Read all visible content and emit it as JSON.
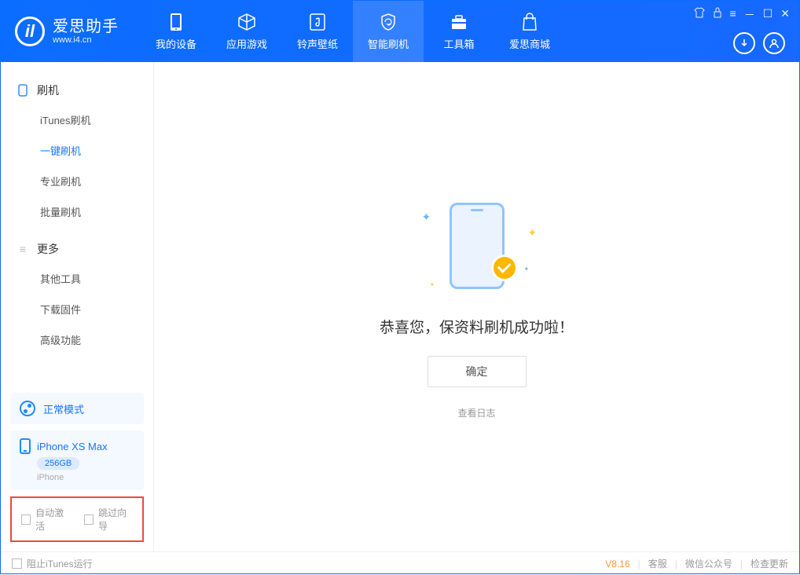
{
  "app": {
    "title": "爱思助手",
    "subtitle": "www.i4.cn"
  },
  "nav": {
    "items": [
      {
        "label": "我的设备"
      },
      {
        "label": "应用游戏"
      },
      {
        "label": "铃声壁纸"
      },
      {
        "label": "智能刷机"
      },
      {
        "label": "工具箱"
      },
      {
        "label": "爱思商城"
      }
    ]
  },
  "sidebar": {
    "group1": {
      "title": "刷机",
      "items": [
        "iTunes刷机",
        "一键刷机",
        "专业刷机",
        "批量刷机"
      ]
    },
    "group2": {
      "title": "更多",
      "items": [
        "其他工具",
        "下载固件",
        "高级功能"
      ]
    },
    "mode": "正常模式",
    "device": {
      "name": "iPhone XS Max",
      "capacity": "256GB",
      "type": "iPhone"
    },
    "options": {
      "auto_activate": "自动激活",
      "skip_guide": "跳过向导"
    }
  },
  "main": {
    "success": "恭喜您，保资料刷机成功啦！",
    "ok": "确定",
    "view_log": "查看日志"
  },
  "footer": {
    "block_itunes": "阻止iTunes运行",
    "version": "V8.16",
    "support": "客服",
    "wechat": "微信公众号",
    "update": "检查更新"
  }
}
